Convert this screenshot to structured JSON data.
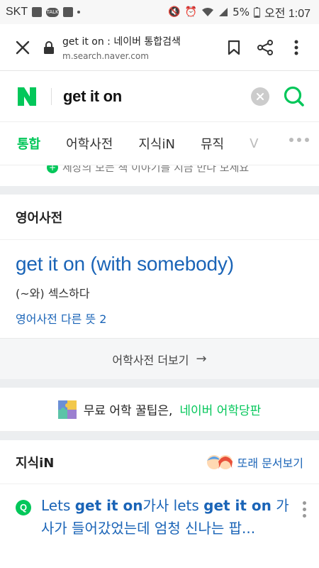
{
  "status_bar": {
    "carrier": "SKT",
    "talk_badge": "TALK",
    "battery": "5%",
    "time": "오전 1:07"
  },
  "browser": {
    "page_title": "get it on : 네이버 통합검색",
    "host": "m.search.naver.com"
  },
  "search": {
    "logo_letter": "N",
    "query": "get it on"
  },
  "tabs": {
    "items": [
      "통합",
      "어학사전",
      "지식iN",
      "뮤직",
      "V"
    ]
  },
  "clipped_line": {
    "text": "세상의 모든 책 이야기를 지금 만나 보세요"
  },
  "dictionary": {
    "section_title": "영어사전",
    "headword": "get it on (with somebody)",
    "meaning": "(~와) 섹스하다",
    "other_meanings": "영어사전 다른 뜻 2",
    "more_label": "어학사전 더보기",
    "more_arrow": "→"
  },
  "tip": {
    "prefix": "무료 어학 꿀팁은,",
    "highlight": "네이버 어학당판"
  },
  "kin": {
    "section_title": "지식iN",
    "peer_link": "또래 문서보기",
    "item": {
      "badge": "Q",
      "t1": "Lets ",
      "b1": "get it on",
      "t2": "가사 lets ",
      "b2": "get it on",
      "t3": " 가사가 들어갔었는데 엄청 신나는 팝..."
    }
  },
  "colors": {
    "naver_green": "#03c75a",
    "link_blue": "#1a64b7"
  }
}
